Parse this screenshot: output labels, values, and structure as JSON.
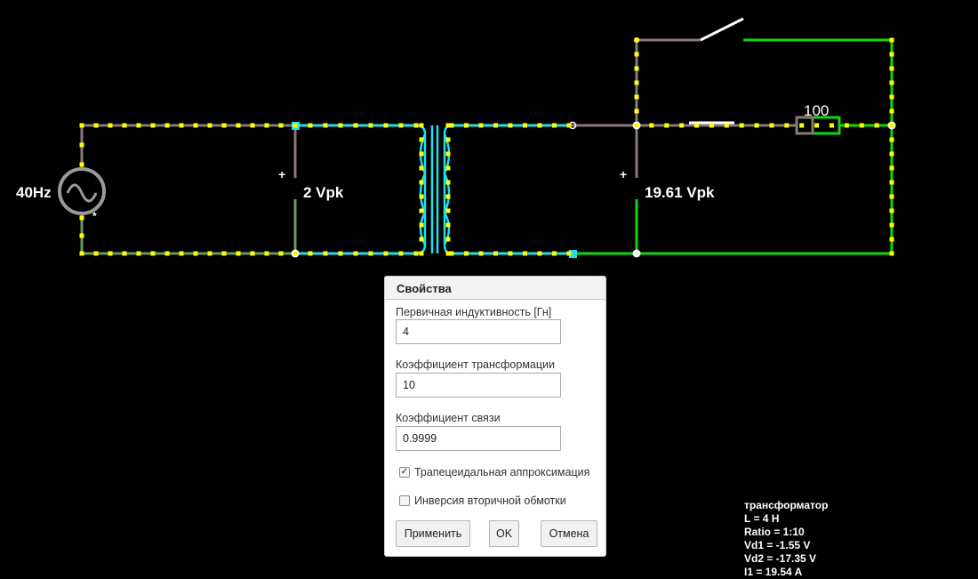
{
  "circuit": {
    "source_label": "40Hz",
    "source_marker": "*",
    "voltmeter1_plus": "+",
    "voltmeter1_value": "2 Vpk",
    "voltmeter2_plus": "+",
    "voltmeter2_value": "19.61 Vpk",
    "resistor_value": "100",
    "colors": {
      "wire_gray": "#877a78",
      "wire_green_dim": "#6a9a5e",
      "wire_cyan": "#1fe0e8",
      "wire_green": "#10d810",
      "current_dot": "#ffff00",
      "node": "#ffffff"
    }
  },
  "dialog": {
    "title": "Свойства",
    "fields": [
      {
        "label": "Первичная индуктивность [Гн]",
        "value": "4"
      },
      {
        "label": "Коэффициент трансформации",
        "value": "10"
      },
      {
        "label": "Коэффициент связи",
        "value": "0.9999"
      }
    ],
    "checkboxes": [
      {
        "label": "Трапецеидальная аппроксимация",
        "checked": true
      },
      {
        "label": "Инверсия вторичной обмотки",
        "checked": false
      }
    ],
    "buttons": {
      "apply": "Применить",
      "ok": "OK",
      "cancel": "Отмена"
    }
  },
  "info": {
    "lines": [
      "трансформатор",
      "L = 4 H",
      "Ratio = 1:10",
      "Vd1 = -1.55 V",
      "Vd2 = -17.35 V",
      "I1 = 19.54 A"
    ]
  }
}
